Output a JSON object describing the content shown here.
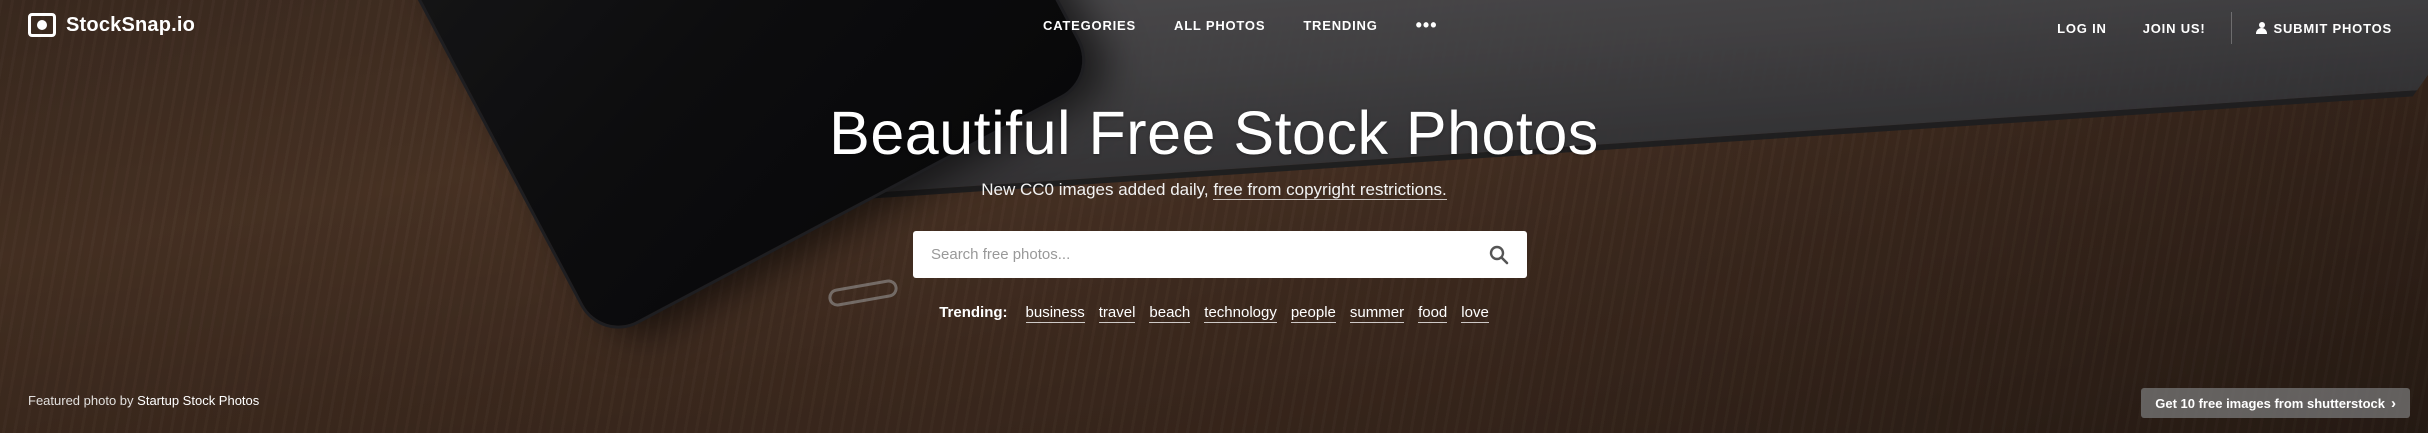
{
  "brand": {
    "name": "StockSnap.io",
    "icon": "camera-icon"
  },
  "nav": {
    "center": [
      {
        "label": "CATEGORIES"
      },
      {
        "label": "ALL PHOTOS"
      },
      {
        "label": "TRENDING"
      }
    ],
    "more_label": "•••",
    "right": {
      "login": "LOG IN",
      "join": "JOIN US!",
      "submit": "SUBMIT PHOTOS",
      "submit_icon": "user-icon"
    }
  },
  "hero": {
    "title": "Beautiful Free Stock Photos",
    "subtitle_prefix": "New CC0 images added daily,",
    "subtitle_link": "free from copyright restrictions."
  },
  "search": {
    "placeholder": "Search free photos...",
    "value": "",
    "icon": "search-icon"
  },
  "trending": {
    "label": "Trending:",
    "tags": [
      "business",
      "travel",
      "beach",
      "technology",
      "people",
      "summer",
      "food",
      "love"
    ]
  },
  "credit": {
    "prefix": "Featured photo by",
    "author": "Startup Stock Photos"
  },
  "promo": {
    "label": "Get 10 free images from shutterstock",
    "icon": "chevron-right-icon"
  },
  "colors": {
    "text": "#ffffff",
    "search_bg": "#ffffff",
    "promo_bg": "#787878"
  }
}
